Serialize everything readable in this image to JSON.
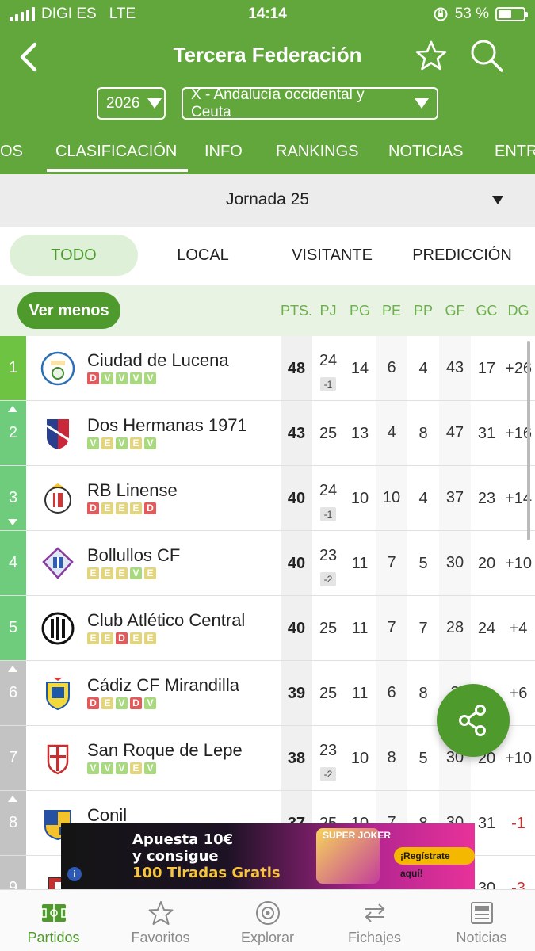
{
  "status": {
    "carrier": "DIGI ES",
    "network": "LTE",
    "time": "14:14",
    "battery": "53 %",
    "battery_level": 0.53
  },
  "header": {
    "title": "Tercera Federación",
    "season": "2026",
    "group": "X - Andalucía occidental y Ceuta"
  },
  "tabs": [
    "OS",
    "CLASIFICACIÓN",
    "INFO",
    "RANKINGS",
    "NOTICIAS",
    "ENTR"
  ],
  "jornada": "Jornada 25",
  "chips": [
    "TODO",
    "LOCAL",
    "VISITANTE",
    "PREDICCIÓN"
  ],
  "table": {
    "toggle_label": "Ver menos",
    "columns": [
      "PTS.",
      "PJ",
      "PG",
      "PE",
      "PP",
      "GF",
      "GC",
      "DG"
    ],
    "rows": [
      {
        "pos": "1",
        "team": "Ciudad de Lucena",
        "form": [
          "D",
          "V",
          "V",
          "V",
          "V"
        ],
        "pts": "48",
        "pj": "24",
        "pen": "-1",
        "pg": "14",
        "pe": "6",
        "pp": "4",
        "gf": "43",
        "gc": "17",
        "dg": "+26"
      },
      {
        "pos": "2",
        "team": "Dos Hermanas 1971",
        "form": [
          "V",
          "E",
          "V",
          "E",
          "V"
        ],
        "pts": "43",
        "pj": "25",
        "pen": "",
        "pg": "13",
        "pe": "4",
        "pp": "8",
        "gf": "47",
        "gc": "31",
        "dg": "+16"
      },
      {
        "pos": "3",
        "team": "RB Linense",
        "form": [
          "D",
          "E",
          "E",
          "E",
          "D"
        ],
        "pts": "40",
        "pj": "24",
        "pen": "-1",
        "pg": "10",
        "pe": "10",
        "pp": "4",
        "gf": "37",
        "gc": "23",
        "dg": "+14"
      },
      {
        "pos": "4",
        "team": "Bollullos CF",
        "form": [
          "E",
          "E",
          "E",
          "V",
          "E"
        ],
        "pts": "40",
        "pj": "23",
        "pen": "-2",
        "pg": "11",
        "pe": "7",
        "pp": "5",
        "gf": "30",
        "gc": "20",
        "dg": "+10"
      },
      {
        "pos": "5",
        "team": "Club Atlético Central",
        "form": [
          "E",
          "E",
          "D",
          "E",
          "E"
        ],
        "pts": "40",
        "pj": "25",
        "pen": "",
        "pg": "11",
        "pe": "7",
        "pp": "7",
        "gf": "28",
        "gc": "24",
        "dg": "+4"
      },
      {
        "pos": "6",
        "team": "Cádiz CF Mirandilla",
        "form": [
          "D",
          "E",
          "V",
          "D",
          "V"
        ],
        "pts": "39",
        "pj": "25",
        "pen": "",
        "pg": "11",
        "pe": "6",
        "pp": "8",
        "gf": "3",
        "gc": "",
        "dg": "+6"
      },
      {
        "pos": "7",
        "team": "San Roque de Lepe",
        "form": [
          "V",
          "V",
          "V",
          "E",
          "V"
        ],
        "pts": "38",
        "pj": "23",
        "pen": "-2",
        "pg": "10",
        "pe": "8",
        "pp": "5",
        "gf": "30",
        "gc": "20",
        "dg": "+10"
      },
      {
        "pos": "8",
        "team": "Conil",
        "form": [],
        "pts": "37",
        "pj": "25",
        "pen": "",
        "pg": "10",
        "pe": "7",
        "pp": "8",
        "gf": "30",
        "gc": "31",
        "dg": "-1"
      },
      {
        "pos": "9",
        "team": "",
        "form": [],
        "pts": "",
        "pj": "",
        "pen": "",
        "pg": "",
        "pe": "",
        "pp": "",
        "gf": "",
        "gc": "30",
        "dg": "-3"
      }
    ]
  },
  "ad": {
    "line1": "Apuesta 10€",
    "line2": "y consigue",
    "line3": "100 Tiradas Gratis",
    "logo": "SUPER JOKER",
    "cta": "¡Regístrate aquí!"
  },
  "nav": [
    "Partidos",
    "Favoritos",
    "Explorar",
    "Fichajes",
    "Noticias"
  ],
  "colors": {
    "brand": "#62a73b",
    "accent": "#4e9a2c",
    "loss": "#e25a5a",
    "draw": "#e3d57e",
    "win": "#a9d97f"
  }
}
